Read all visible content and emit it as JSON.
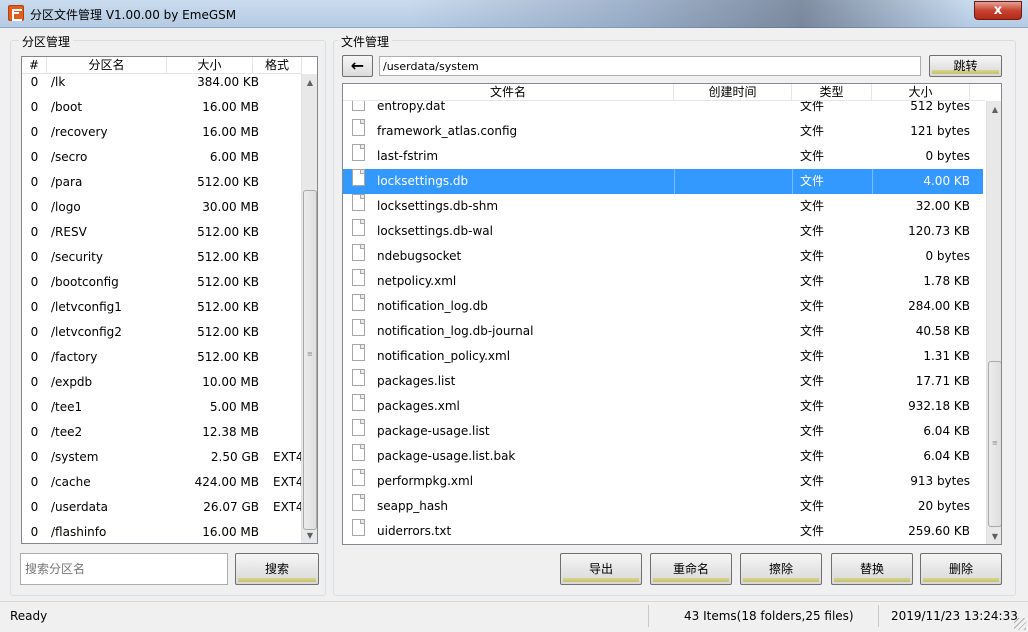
{
  "window": {
    "title": "分区文件管理 V1.00.00 by EmeGSM",
    "close_label": "x"
  },
  "partition_manager": {
    "group_label": "分区管理",
    "columns": [
      "#",
      "分区名",
      "大小",
      "格式"
    ],
    "rows": [
      {
        "idx": "0",
        "name": "/lk",
        "size": "384.00 KB",
        "format": ""
      },
      {
        "idx": "0",
        "name": "/boot",
        "size": "16.00 MB",
        "format": ""
      },
      {
        "idx": "0",
        "name": "/recovery",
        "size": "16.00 MB",
        "format": ""
      },
      {
        "idx": "0",
        "name": "/secro",
        "size": "6.00 MB",
        "format": ""
      },
      {
        "idx": "0",
        "name": "/para",
        "size": "512.00 KB",
        "format": ""
      },
      {
        "idx": "0",
        "name": "/logo",
        "size": "30.00 MB",
        "format": ""
      },
      {
        "idx": "0",
        "name": "/RESV",
        "size": "512.00 KB",
        "format": ""
      },
      {
        "idx": "0",
        "name": "/security",
        "size": "512.00 KB",
        "format": ""
      },
      {
        "idx": "0",
        "name": "/bootconfig",
        "size": "512.00 KB",
        "format": ""
      },
      {
        "idx": "0",
        "name": "/letvconfig1",
        "size": "512.00 KB",
        "format": ""
      },
      {
        "idx": "0",
        "name": "/letvconfig2",
        "size": "512.00 KB",
        "format": ""
      },
      {
        "idx": "0",
        "name": "/factory",
        "size": "512.00 KB",
        "format": ""
      },
      {
        "idx": "0",
        "name": "/expdb",
        "size": "10.00 MB",
        "format": ""
      },
      {
        "idx": "0",
        "name": "/tee1",
        "size": "5.00 MB",
        "format": ""
      },
      {
        "idx": "0",
        "name": "/tee2",
        "size": "12.38 MB",
        "format": ""
      },
      {
        "idx": "0",
        "name": "/system",
        "size": "2.50 GB",
        "format": "EXT4"
      },
      {
        "idx": "0",
        "name": "/cache",
        "size": "424.00 MB",
        "format": "EXT4"
      },
      {
        "idx": "0",
        "name": "/userdata",
        "size": "26.07 GB",
        "format": "EXT4"
      },
      {
        "idx": "0",
        "name": "/flashinfo",
        "size": "16.00 MB",
        "format": ""
      }
    ],
    "search_placeholder": "搜索分区名",
    "search_button": "搜索"
  },
  "file_manager": {
    "group_label": "文件管理",
    "path": "/userdata/system",
    "jump_button": "跳转",
    "columns": [
      "文件名",
      "创建时间",
      "类型",
      "大小"
    ],
    "partial_top_row": {
      "name": "entropy.dat",
      "type": "文件",
      "size": "512 bytes"
    },
    "rows": [
      {
        "name": "framework_atlas.config",
        "time": "",
        "type": "文件",
        "size": "121 bytes",
        "selected": false
      },
      {
        "name": "last-fstrim",
        "time": "",
        "type": "文件",
        "size": "0 bytes",
        "selected": false
      },
      {
        "name": "locksettings.db",
        "time": "",
        "type": "文件",
        "size": "4.00 KB",
        "selected": true
      },
      {
        "name": "locksettings.db-shm",
        "time": "",
        "type": "文件",
        "size": "32.00 KB",
        "selected": false
      },
      {
        "name": "locksettings.db-wal",
        "time": "",
        "type": "文件",
        "size": "120.73 KB",
        "selected": false
      },
      {
        "name": "ndebugsocket",
        "time": "",
        "type": "文件",
        "size": "0 bytes",
        "selected": false
      },
      {
        "name": "netpolicy.xml",
        "time": "",
        "type": "文件",
        "size": "1.78 KB",
        "selected": false
      },
      {
        "name": "notification_log.db",
        "time": "",
        "type": "文件",
        "size": "284.00 KB",
        "selected": false
      },
      {
        "name": "notification_log.db-journal",
        "time": "",
        "type": "文件",
        "size": "40.58 KB",
        "selected": false
      },
      {
        "name": "notification_policy.xml",
        "time": "",
        "type": "文件",
        "size": "1.31 KB",
        "selected": false
      },
      {
        "name": "packages.list",
        "time": "",
        "type": "文件",
        "size": "17.71 KB",
        "selected": false
      },
      {
        "name": "packages.xml",
        "time": "",
        "type": "文件",
        "size": "932.18 KB",
        "selected": false
      },
      {
        "name": "package-usage.list",
        "time": "",
        "type": "文件",
        "size": "6.04 KB",
        "selected": false
      },
      {
        "name": "package-usage.list.bak",
        "time": "",
        "type": "文件",
        "size": "6.04 KB",
        "selected": false
      },
      {
        "name": "performpkg.xml",
        "time": "",
        "type": "文件",
        "size": "913 bytes",
        "selected": false
      },
      {
        "name": "seapp_hash",
        "time": "",
        "type": "文件",
        "size": "20 bytes",
        "selected": false
      },
      {
        "name": "uiderrors.txt",
        "time": "",
        "type": "文件",
        "size": "259.60 KB",
        "selected": false
      }
    ],
    "actions": {
      "export": "导出",
      "rename": "重命名",
      "erase": "擦除",
      "replace": "替换",
      "delete": "删除"
    }
  },
  "status": {
    "state": "Ready",
    "items": "43 Items(18 folders,25 files)",
    "datetime": "2019/11/23 13:24:33"
  },
  "icons": {
    "app": "app-logo-icon",
    "back": "arrow-left-icon",
    "file": "file-icon",
    "close": "close-icon"
  },
  "colors": {
    "selection": "#3399ff",
    "button_accent": "#c5c070",
    "app_icon": "#e35d1a"
  }
}
